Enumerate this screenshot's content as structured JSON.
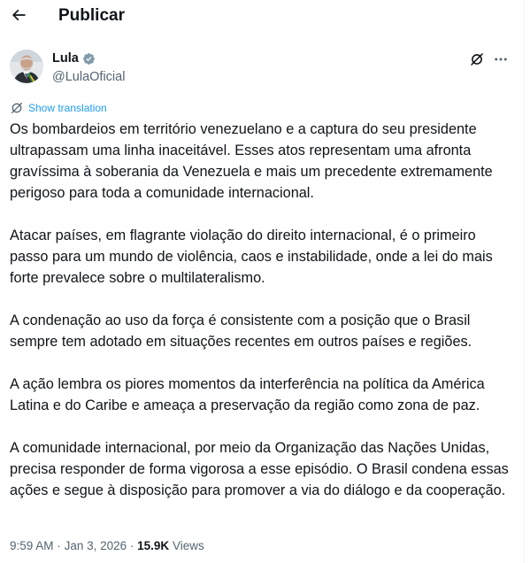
{
  "header": {
    "title": "Publicar",
    "back_icon": "arrow-left-icon"
  },
  "author": {
    "display_name": "Lula",
    "handle": "@LulaOficial",
    "verified_icon": "verified-badge-icon",
    "badge_color": "#829aab"
  },
  "actions": {
    "grok_icon": "grok-icon",
    "more_icon": "more-horizontal-icon"
  },
  "translate": {
    "label": "Show translation",
    "icon": "translate-globe-icon"
  },
  "post": {
    "paragraphs": [
      "Os bombardeios em território venezuelano e a captura do seu presidente ultrapassam uma linha inaceitável. Esses atos representam uma afronta gravíssima à soberania da Venezuela e mais um precedente extremamente perigoso para toda a comunidade internacional.",
      "Atacar países, em flagrante violação do direito internacional, é o primeiro passo para um mundo de violência, caos e instabilidade, onde a lei do mais forte prevalece sobre o multilateralismo.",
      "A condenação ao uso da força é consistente com a posição que o Brasil sempre tem adotado em situações recentes em outros países e regiões.",
      "A ação lembra os piores momentos da interferência na política da América Latina e do Caribe e ameaça a preservação da região como zona de paz.",
      "A comunidade internacional, por meio da Organização das Nações Unidas, precisa responder de forma vigorosa a esse episódio. O Brasil condena essas ações e segue à disposição para promover a via do diálogo e da cooperação."
    ]
  },
  "meta": {
    "time": "9:59 AM",
    "separator": "·",
    "date": "Jan 3, 2026",
    "views_count": "15.9K",
    "views_label": "Views"
  },
  "colors": {
    "text": "#0f1419",
    "secondary": "#536471",
    "link": "#1d9bf0"
  }
}
